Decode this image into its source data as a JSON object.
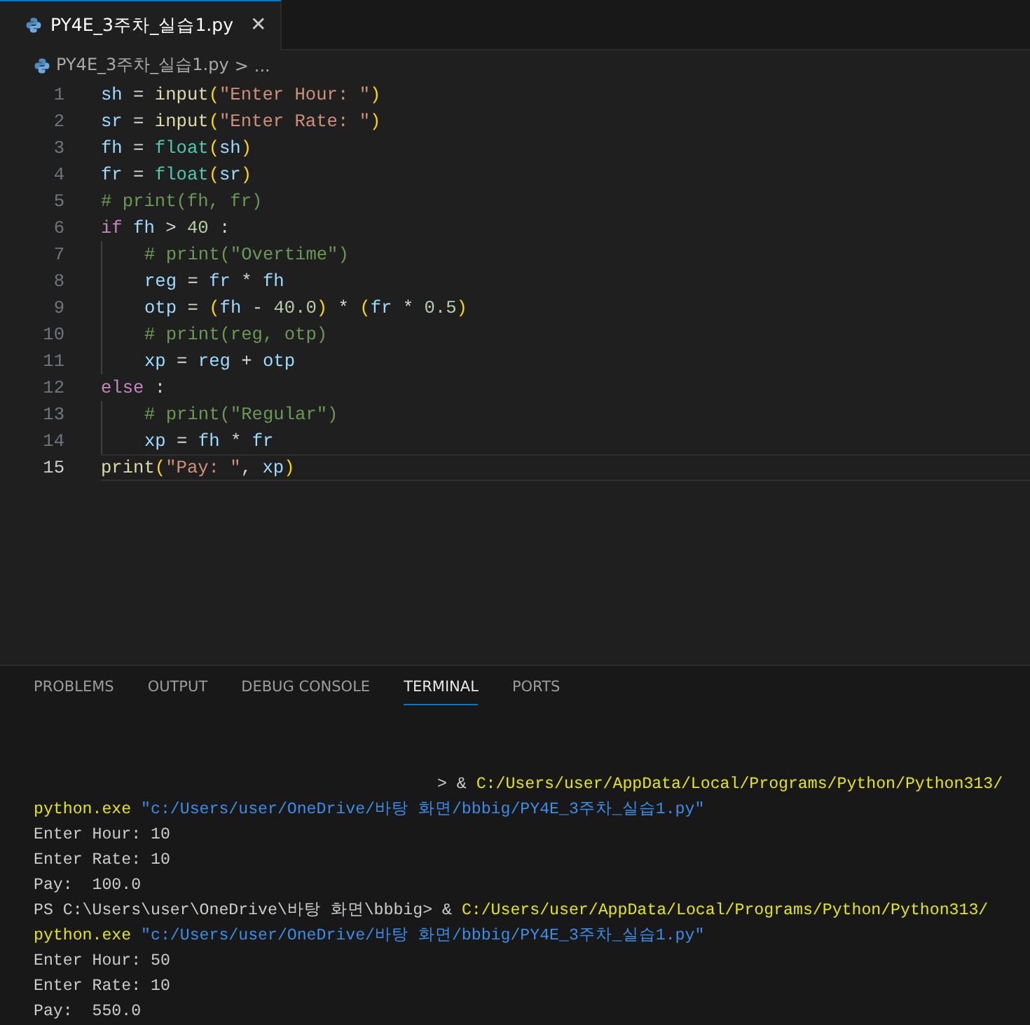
{
  "tabs": [
    {
      "label": "PY4E_3주차_실습1.py",
      "selected": true,
      "close": "✕"
    }
  ],
  "breadcrumb": {
    "file": "PY4E_3주차_실습1.py",
    "separator": ">",
    "rest": "..."
  },
  "code": [
    {
      "number": "1",
      "indented": false,
      "current": false,
      "tokens": [
        {
          "t": "sh",
          "kind": "var"
        },
        {
          "t": " = ",
          "kind": "op"
        },
        {
          "t": "input",
          "kind": "fn"
        },
        {
          "t": "(",
          "kind": "paren"
        },
        {
          "t": "\"Enter Hour: \"",
          "kind": "str"
        },
        {
          "t": ")",
          "kind": "paren"
        }
      ]
    },
    {
      "number": "2",
      "indented": false,
      "current": false,
      "tokens": [
        {
          "t": "sr",
          "kind": "var"
        },
        {
          "t": " = ",
          "kind": "op"
        },
        {
          "t": "input",
          "kind": "fn"
        },
        {
          "t": "(",
          "kind": "paren"
        },
        {
          "t": "\"Enter Rate: \"",
          "kind": "str"
        },
        {
          "t": ")",
          "kind": "paren"
        }
      ]
    },
    {
      "number": "3",
      "indented": false,
      "current": false,
      "tokens": [
        {
          "t": "fh",
          "kind": "var"
        },
        {
          "t": " = ",
          "kind": "op"
        },
        {
          "t": "float",
          "kind": "type"
        },
        {
          "t": "(",
          "kind": "paren"
        },
        {
          "t": "sh",
          "kind": "var"
        },
        {
          "t": ")",
          "kind": "paren"
        }
      ]
    },
    {
      "number": "4",
      "indented": false,
      "current": false,
      "tokens": [
        {
          "t": "fr",
          "kind": "var"
        },
        {
          "t": " = ",
          "kind": "op"
        },
        {
          "t": "float",
          "kind": "type"
        },
        {
          "t": "(",
          "kind": "paren"
        },
        {
          "t": "sr",
          "kind": "var"
        },
        {
          "t": ")",
          "kind": "paren"
        }
      ]
    },
    {
      "number": "5",
      "indented": false,
      "current": false,
      "tokens": [
        {
          "t": "# print(fh, fr)",
          "kind": "comment"
        }
      ]
    },
    {
      "number": "6",
      "indented": false,
      "current": false,
      "tokens": [
        {
          "t": "if",
          "kind": "kw"
        },
        {
          "t": " fh",
          "kind": "var"
        },
        {
          "t": " > ",
          "kind": "op"
        },
        {
          "t": "40",
          "kind": "num"
        },
        {
          "t": " :",
          "kind": "op"
        }
      ]
    },
    {
      "number": "7",
      "indented": true,
      "current": false,
      "tokens": [
        {
          "t": "# print(\"Overtime\")",
          "kind": "comment"
        }
      ]
    },
    {
      "number": "8",
      "indented": true,
      "current": false,
      "tokens": [
        {
          "t": "reg",
          "kind": "var"
        },
        {
          "t": " = ",
          "kind": "op"
        },
        {
          "t": "fr",
          "kind": "var"
        },
        {
          "t": " * ",
          "kind": "op"
        },
        {
          "t": "fh",
          "kind": "var"
        }
      ]
    },
    {
      "number": "9",
      "indented": true,
      "current": false,
      "tokens": [
        {
          "t": "otp",
          "kind": "var"
        },
        {
          "t": " = ",
          "kind": "op"
        },
        {
          "t": "(",
          "kind": "paren"
        },
        {
          "t": "fh",
          "kind": "var"
        },
        {
          "t": " - ",
          "kind": "op"
        },
        {
          "t": "40.0",
          "kind": "num"
        },
        {
          "t": ")",
          "kind": "paren"
        },
        {
          "t": " * ",
          "kind": "op"
        },
        {
          "t": "(",
          "kind": "paren"
        },
        {
          "t": "fr",
          "kind": "var"
        },
        {
          "t": " * ",
          "kind": "op"
        },
        {
          "t": "0.5",
          "kind": "num"
        },
        {
          "t": ")",
          "kind": "paren"
        }
      ]
    },
    {
      "number": "10",
      "indented": true,
      "current": false,
      "tokens": [
        {
          "t": "# print(reg, otp)",
          "kind": "comment"
        }
      ]
    },
    {
      "number": "11",
      "indented": true,
      "current": false,
      "tokens": [
        {
          "t": "xp",
          "kind": "var"
        },
        {
          "t": " = ",
          "kind": "op"
        },
        {
          "t": "reg",
          "kind": "var"
        },
        {
          "t": " + ",
          "kind": "op"
        },
        {
          "t": "otp",
          "kind": "var"
        }
      ]
    },
    {
      "number": "12",
      "indented": false,
      "current": false,
      "tokens": [
        {
          "t": "else",
          "kind": "kw"
        },
        {
          "t": " :",
          "kind": "op"
        }
      ]
    },
    {
      "number": "13",
      "indented": true,
      "current": false,
      "tokens": [
        {
          "t": "# print(\"Regular\")",
          "kind": "comment"
        }
      ]
    },
    {
      "number": "14",
      "indented": true,
      "current": false,
      "tokens": [
        {
          "t": "xp",
          "kind": "var"
        },
        {
          "t": " = ",
          "kind": "op"
        },
        {
          "t": "fh",
          "kind": "var"
        },
        {
          "t": " * ",
          "kind": "op"
        },
        {
          "t": "fr",
          "kind": "var"
        }
      ]
    },
    {
      "number": "15",
      "indented": false,
      "current": true,
      "tokens": [
        {
          "t": "print",
          "kind": "fn"
        },
        {
          "t": "(",
          "kind": "paren"
        },
        {
          "t": "\"Pay: \"",
          "kind": "str"
        },
        {
          "t": ", ",
          "kind": "op"
        },
        {
          "t": "xp",
          "kind": "var"
        },
        {
          "t": ")",
          "kind": "paren"
        }
      ]
    }
  ],
  "panel_tabs": [
    {
      "label": "PROBLEMS",
      "selected": false
    },
    {
      "label": "OUTPUT",
      "selected": false
    },
    {
      "label": "DEBUG CONSOLE",
      "selected": false
    },
    {
      "label": "TERMINAL",
      "selected": true
    },
    {
      "label": "PORTS",
      "selected": false
    }
  ],
  "terminal": [
    {
      "kind": "continued",
      "segments": [
        {
          "t": "> & ",
          "kind": "plain"
        },
        {
          "t": "C:/Users/user/AppData/Local/Programs/Python/Python313/",
          "kind": "cmd"
        }
      ]
    },
    {
      "kind": "line",
      "segments": [
        {
          "t": "python.exe",
          "kind": "cmd"
        },
        {
          "t": " \"c:/Users/user/OneDrive/바탕 화면/bbbig/PY4E_3주차_실습1.py\"",
          "kind": "str"
        }
      ]
    },
    {
      "kind": "line",
      "segments": [
        {
          "t": "Enter Hour: 10",
          "kind": "plain"
        }
      ]
    },
    {
      "kind": "line",
      "segments": [
        {
          "t": "Enter Rate: 10",
          "kind": "plain"
        }
      ]
    },
    {
      "kind": "line",
      "segments": [
        {
          "t": "Pay:  100.0",
          "kind": "plain"
        }
      ]
    },
    {
      "kind": "line",
      "segments": [
        {
          "t": "PS C:\\Users\\user\\OneDrive\\바탕 화면\\bbbig> & ",
          "kind": "plain"
        },
        {
          "t": "C:/Users/user/AppData/Local/Programs/Python/Python313/",
          "kind": "cmd"
        }
      ]
    },
    {
      "kind": "line",
      "segments": [
        {
          "t": "python.exe",
          "kind": "cmd"
        },
        {
          "t": " \"c:/Users/user/OneDrive/바탕 화면/bbbig/PY4E_3주차_실습1.py\"",
          "kind": "str"
        }
      ]
    },
    {
      "kind": "line",
      "segments": [
        {
          "t": "Enter Hour: 50",
          "kind": "plain"
        }
      ]
    },
    {
      "kind": "line",
      "segments": [
        {
          "t": "Enter Rate: 10",
          "kind": "plain"
        }
      ]
    },
    {
      "kind": "line",
      "segments": [
        {
          "t": "Pay:  550.0",
          "kind": "plain"
        }
      ]
    }
  ]
}
